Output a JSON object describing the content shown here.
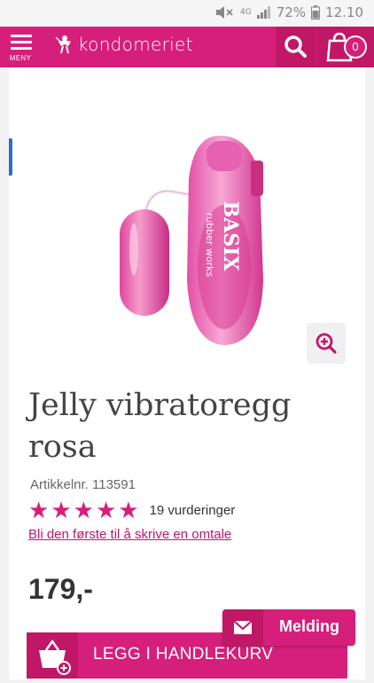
{
  "status_bar": {
    "network": "4G",
    "battery": "72%",
    "time": "12.10",
    "icons": [
      "mute-icon",
      "signal-icon",
      "battery-icon"
    ]
  },
  "header": {
    "menu_label": "MENY",
    "brand": "kondomeriet",
    "cart_count": "0",
    "icons": [
      "hamburger-icon",
      "cupid-logo-icon",
      "search-icon",
      "shopping-bag-icon"
    ]
  },
  "product": {
    "title": "Jelly vibratoregg rosa",
    "sku": "Artikkelnr. 113591",
    "image_brand": "BASIX",
    "image_brand_sub": "rubber works",
    "rating": {
      "stars": 5,
      "count_label": "19 vurderinger"
    },
    "review_link": "Bli den første til å skrive en omtale",
    "price": "179,-"
  },
  "actions": {
    "add_to_cart": "LEGG I HANDLEKURV",
    "message": "Melding"
  },
  "colors": {
    "brand": "#d61f7a",
    "brand_dark": "#c01766",
    "link": "#c0166e",
    "accent_blue": "#2a6fc8"
  }
}
